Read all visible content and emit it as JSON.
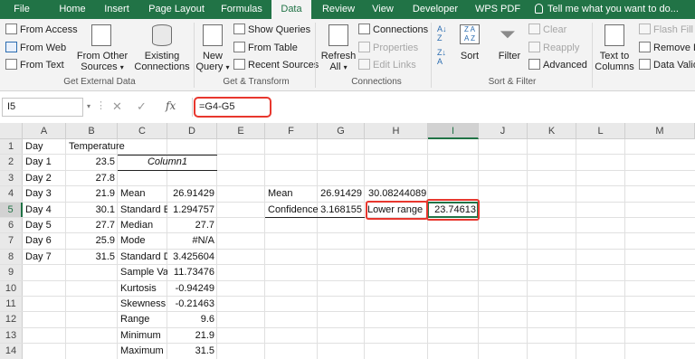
{
  "tabs": [
    "File",
    "Home",
    "Insert",
    "Page Layout",
    "Formulas",
    "Data",
    "Review",
    "View",
    "Developer",
    "WPS PDF"
  ],
  "active_tab": "Data",
  "tell_me": "Tell me what you want to do...",
  "ribbon": {
    "get_external": {
      "from_access": "From Access",
      "from_web": "From Web",
      "from_text": "From Text",
      "from_other_1": "From Other",
      "from_other_2": "Sources",
      "existing_1": "Existing",
      "existing_2": "Connections",
      "label": "Get External Data"
    },
    "get_transform": {
      "new_query_1": "New",
      "new_query_2": "Query",
      "show_queries": "Show Queries",
      "from_table": "From Table",
      "recent_sources": "Recent Sources",
      "label": "Get & Transform"
    },
    "connections": {
      "refresh_1": "Refresh",
      "refresh_2": "All",
      "connections": "Connections",
      "properties": "Properties",
      "edit_links": "Edit Links",
      "label": "Connections"
    },
    "sort_filter": {
      "sort": "Sort",
      "filter": "Filter",
      "clear": "Clear",
      "reapply": "Reapply",
      "advanced": "Advanced",
      "label": "Sort & Filter"
    },
    "data_tools": {
      "text_to_1": "Text to",
      "text_to_2": "Columns",
      "flash_fill": "Flash Fill",
      "remove_dup": "Remove D",
      "data_valid": "Data Valid"
    }
  },
  "formula_bar": {
    "name_box": "I5",
    "formula": "=G4-G5"
  },
  "columns": [
    "A",
    "B",
    "C",
    "D",
    "E",
    "F",
    "G",
    "H",
    "I",
    "J",
    "K",
    "L",
    "M"
  ],
  "selected_column": "I",
  "rows": [
    "1",
    "2",
    "3",
    "4",
    "5",
    "6",
    "7",
    "8",
    "9",
    "10",
    "11",
    "12",
    "13",
    "14"
  ],
  "selected_row": "5",
  "cells": {
    "A1": "Day",
    "B1": "Temperature",
    "A2": "Day 1",
    "B2": "23.5",
    "C2": "Column1",
    "A3": "Day 2",
    "B3": "27.8",
    "A4": "Day 3",
    "B4": "21.9",
    "C4": "Mean",
    "D4": "26.91429",
    "A5": "Day 4",
    "B5": "30.1",
    "C5": "Standard E",
    "D5": "1.294757",
    "A6": "Day 5",
    "B6": "27.7",
    "C6": "Median",
    "D6": "27.7",
    "A7": "Day 6",
    "B7": "25.9",
    "C7": "Mode",
    "D7": "#N/A",
    "A8": "Day 7",
    "B8": "31.5",
    "C8": "Standard D",
    "D8": "3.425604",
    "C9": "Sample Va",
    "D9": "11.73476",
    "C10": "Kurtosis",
    "D10": "-0.94249",
    "C11": "Skewness",
    "D11": "-0.21463",
    "C12": "Range",
    "D12": "9.6",
    "C13": "Minimum",
    "D13": "21.9",
    "C14": "Maximum",
    "D14": "31.5",
    "F4": "Mean",
    "G4": "26.91429",
    "H4": "30.08244089",
    "F5": "Confidence",
    "G5": "3.168155",
    "H5": "Lower range",
    "I5": "23.74613"
  },
  "colors": {
    "accent": "#217346",
    "highlight": "#e8372e"
  }
}
